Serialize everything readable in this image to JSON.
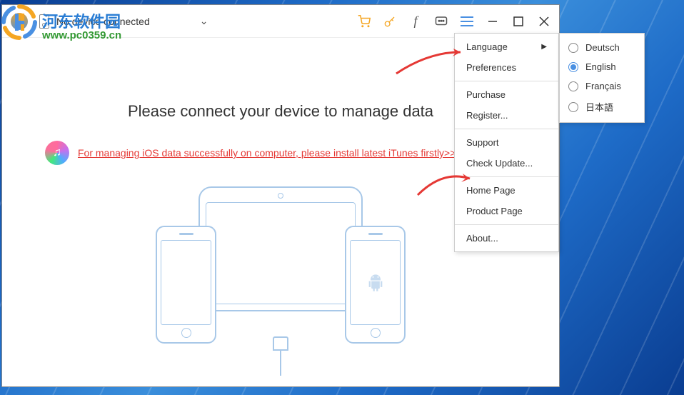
{
  "watermark": {
    "brand_cn": "河东软件园",
    "url": "www.pc0359.cn"
  },
  "titlebar": {
    "device_status": "No device connected"
  },
  "main": {
    "heading": "Please connect your device to manage data",
    "itunes_link": "For managing iOS data successfully on computer, please install latest iTunes firstly>>"
  },
  "menu": {
    "language": "Language",
    "preferences": "Preferences",
    "purchase": "Purchase",
    "register": "Register...",
    "support": "Support",
    "check_update": "Check Update...",
    "home_page": "Home Page",
    "product_page": "Product Page",
    "about": "About..."
  },
  "languages": {
    "de": "Deutsch",
    "en": "English",
    "fr": "Français",
    "jp": "日本語",
    "selected": "en"
  }
}
